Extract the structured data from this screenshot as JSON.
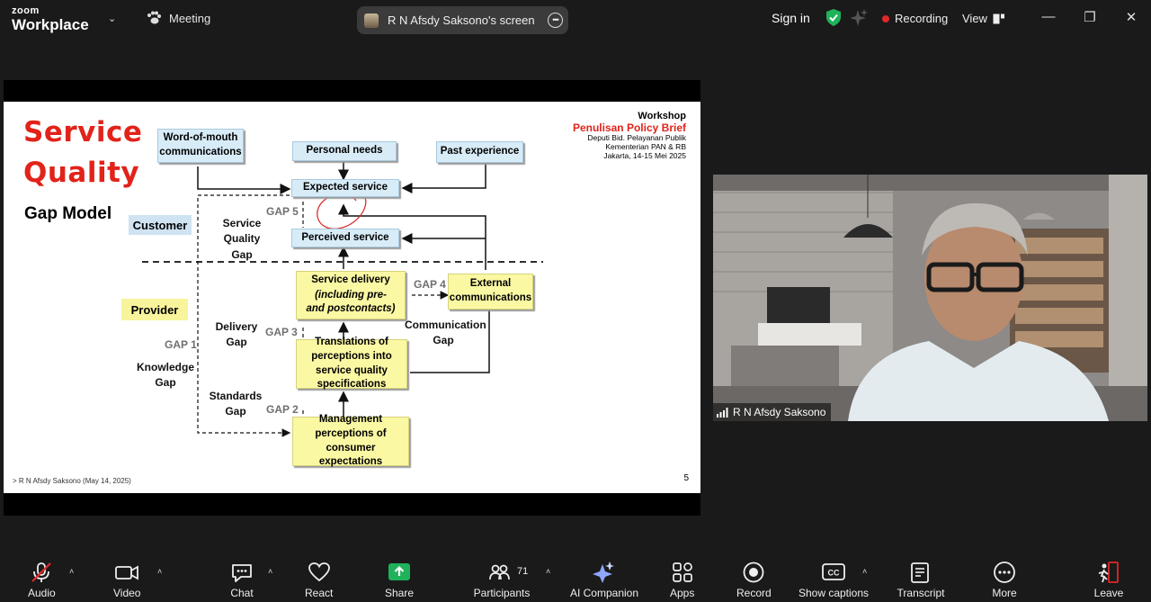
{
  "topbar": {
    "brand_small": "zoom",
    "brand_large": "Workplace",
    "meeting_label": "Meeting",
    "screen_share_label": "R N Afsdy Saksono's screen",
    "sign_in": "Sign in",
    "recording_label": "Recording",
    "view_label": "View",
    "colors": {
      "recording_dot": "#e02828",
      "shield": "#1fb25a"
    }
  },
  "slide": {
    "title_line1": "Service",
    "title_line2": "Quality",
    "subtitle": "Gap Model",
    "workshop": {
      "label": "Workshop",
      "title": "Penulisan Policy Brief",
      "line1": "Deputi Bid. Pelayanan Publik",
      "line2": "Kementerian PAN & RB",
      "line3": "Jakarta, 14-15 Mei 2025"
    },
    "footer": "> R N Afsdy Saksono (May 14, 2025)",
    "page_number": "5",
    "diagram": {
      "customer_label": "Customer",
      "provider_label": "Provider",
      "boxes": {
        "word_of_mouth": "Word-of-mouth communications",
        "personal_needs": "Personal needs",
        "past_experience": "Past experience",
        "expected_service": "Expected service",
        "perceived_service": "Perceived service",
        "service_delivery_1": "Service delivery",
        "service_delivery_2": "(including pre-and postcontacts)",
        "external_comms": "External communications",
        "translations": "Translations of perceptions into service quality specifications",
        "management": "Management perceptions of consumer expectations"
      },
      "gaps": {
        "gap5": "GAP 5",
        "gap4": "GAP 4",
        "gap3": "GAP 3",
        "gap2": "GAP 2",
        "gap1": "GAP 1"
      },
      "gap_names": {
        "service_quality_1": "Service Quality",
        "service_quality_2": "Gap",
        "delivery": "Delivery Gap",
        "communication_1": "Communication",
        "communication_2": "Gap",
        "standards_1": "Standards",
        "standards_2": "Gap",
        "knowledge_1": "Knowledge",
        "knowledge_2": "Gap"
      }
    }
  },
  "video": {
    "participant_name": "R N Afsdy Saksono"
  },
  "toolbar": {
    "audio": "Audio",
    "video": "Video",
    "chat": "Chat",
    "react": "React",
    "share": "Share",
    "participants": "Participants",
    "participants_count": "71",
    "ai_companion": "AI Companion",
    "apps": "Apps",
    "record": "Record",
    "show_captions": "Show captions",
    "transcript": "Transcript",
    "more": "More",
    "leave": "Leave",
    "colors": {
      "share_green": "#1fb25a",
      "leave_red": "#e02828",
      "mute_red": "#e02828"
    }
  }
}
